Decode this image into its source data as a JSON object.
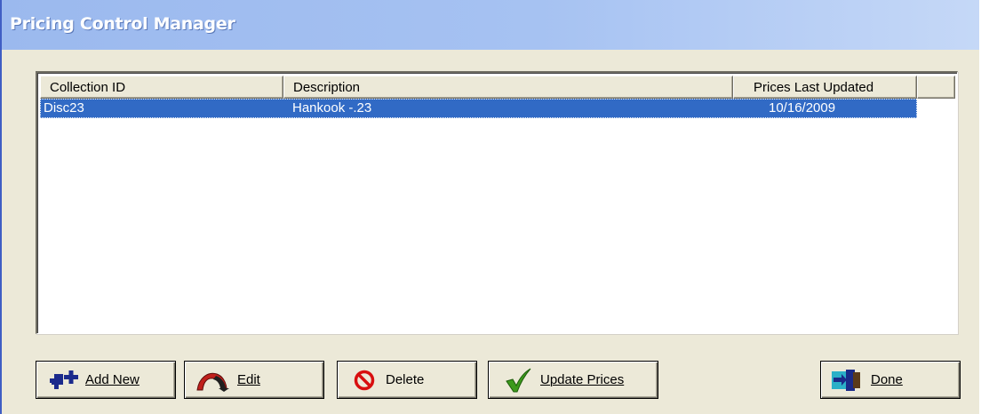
{
  "window": {
    "title": "Pricing Control Manager"
  },
  "list": {
    "columns": [
      "Collection ID",
      "Description",
      "Prices Last Updated"
    ],
    "rows": [
      {
        "collection_id": "Disc23",
        "description": "Hankook -.23",
        "prices_last_updated": "10/16/2009"
      }
    ]
  },
  "buttons": {
    "add_new": {
      "label": "Add New",
      "icon": "add-icon"
    },
    "edit": {
      "label": "Edit",
      "icon": "edit-arrow-icon"
    },
    "delete": {
      "label": "Delete",
      "icon": "no-entry-icon"
    },
    "update_prices": {
      "label": "Update Prices",
      "icon": "checkmark-icon"
    },
    "done": {
      "label": "Done",
      "icon": "exit-door-icon"
    }
  },
  "colors": {
    "selection": "#316ac5",
    "title_bar": "#a6c2f2",
    "window_face": "#ece9d8"
  }
}
